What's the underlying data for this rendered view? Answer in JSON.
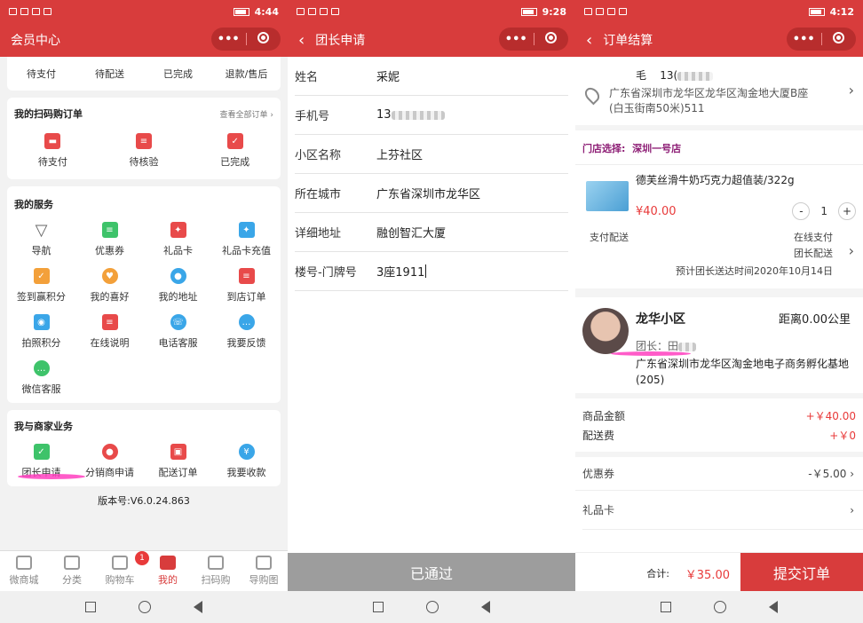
{
  "colors": {
    "brand": "#d83c3c",
    "price": "#e83a3a",
    "store": "#8e1f76",
    "disabled": "#9d9d9d"
  },
  "phone1": {
    "status_time": "4:44",
    "title": "会员中心",
    "orders_row": [
      "待支付",
      "待配送",
      "已完成",
      "退款/售后"
    ],
    "scan_orders": {
      "title": "我的扫码购订单",
      "more": "查看全部订单",
      "items": [
        "待支付",
        "待核验",
        "已完成"
      ]
    },
    "services": {
      "title": "我的服务",
      "items": [
        "导航",
        "优惠券",
        "礼品卡",
        "礼品卡充值",
        "签到赢积分",
        "我的喜好",
        "我的地址",
        "到店订单",
        "拍照积分",
        "在线说明",
        "电话客服",
        "我要反馈",
        "微信客服"
      ]
    },
    "merchant": {
      "title": "我与商家业务",
      "items": [
        "团长申请",
        "分销商申请",
        "配送订单",
        "我要收款"
      ]
    },
    "version": "版本号:V6.0.24.863",
    "tabs": [
      "微商城",
      "分类",
      "购物车",
      "我的",
      "扫码购",
      "导购图"
    ],
    "cart_badge": "1"
  },
  "phone2": {
    "status_time": "9:28",
    "title": "团长申请",
    "fields": [
      {
        "label": "姓名",
        "value": "采妮"
      },
      {
        "label": "手机号",
        "value": "13"
      },
      {
        "label": "小区名称",
        "value": "上芬社区"
      },
      {
        "label": "所在城市",
        "value": "广东省深圳市龙华区"
      },
      {
        "label": "详细地址",
        "value": "融创智汇大厦"
      },
      {
        "label": "楼号-门牌号",
        "value": "3座1911"
      }
    ],
    "button": "已通过"
  },
  "phone3": {
    "status_time": "4:12",
    "title": "订单结算",
    "recipient": "毛",
    "phone_prefix": "13(",
    "address": "广东省深圳市龙华区龙华区淘金地大厦B座(白玉街南50米)511",
    "store_label": "门店选择:",
    "store_name": "深圳一号店",
    "product_name": "德芙丝滑牛奶巧克力超值装/322g",
    "product_price": "¥40.00",
    "qty": "1",
    "ship_label": "支付配送",
    "pay_method": "在线支付",
    "ship_method": "团长配送",
    "eta": "预计团长送达时间2020年10月14日",
    "leader_area": "龙华小区",
    "distance": "距离0.00公里",
    "leader_label": "团长：田",
    "leader_addr": "广东省深圳市龙华区淘金地电子商务孵化基地(205)",
    "goods_label": "商品金额",
    "goods_amount": "+￥40.00",
    "fee_label": "配送费",
    "fee_amount": "+￥0",
    "coupon_label": "优惠券",
    "coupon_amount": "-￥5.00",
    "gift_label": "礼品卡",
    "total_label": "合计:",
    "total": "￥35.00",
    "submit": "提交订单"
  }
}
